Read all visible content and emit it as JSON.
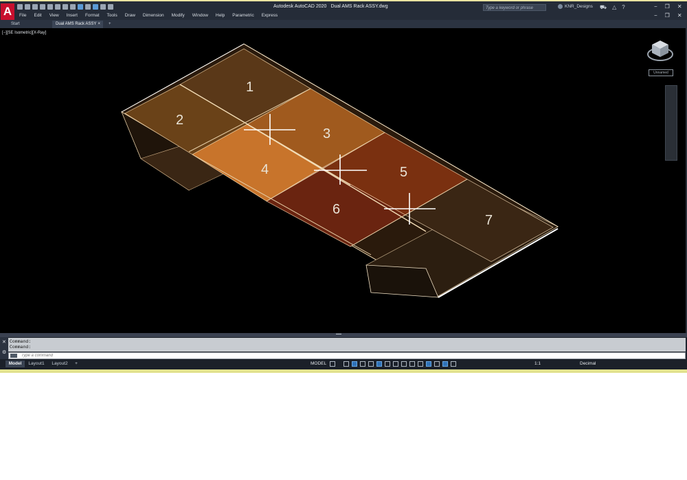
{
  "app": {
    "logo_letter": "A",
    "title": "Autodesk AutoCAD 2020",
    "file_name": "Dual AMS Rack ASSY.dwg",
    "search_placeholder": "Type a keyword or phrase",
    "user_name": "KNR_Designs"
  },
  "menu": [
    "File",
    "Edit",
    "View",
    "Insert",
    "Format",
    "Tools",
    "Draw",
    "Dimension",
    "Modify",
    "Window",
    "Help",
    "Parametric",
    "Express"
  ],
  "tabs": {
    "start": "Start",
    "active": "Dual AMS Rack ASSY",
    "close": "×",
    "add": "+"
  },
  "viewport": {
    "label": "[−][SE Isometric][X-Ray]",
    "ucs_badge": "Unnamed",
    "slot_numbers": [
      "1",
      "2",
      "3",
      "4",
      "5",
      "6",
      "7"
    ]
  },
  "command": {
    "history": [
      "Command:",
      "Command:"
    ],
    "input_placeholder": "Type a command"
  },
  "statusbar": {
    "model_tab": "Model",
    "layout1": "Layout1",
    "layout2": "Layout2",
    "add_layout": "+",
    "model_space": "MODEL",
    "scale": "1:1",
    "units": "Decimal"
  },
  "colors": {
    "accent": "#c8102e",
    "viewport_bg": "#000000",
    "slot_amber": "#c8742b",
    "slot_brown": "#6a2e10"
  }
}
